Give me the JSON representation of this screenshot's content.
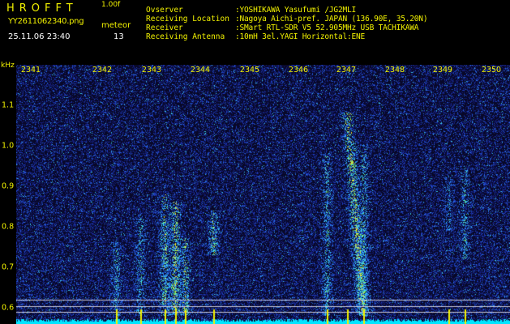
{
  "header": {
    "app_title": "HROFFT",
    "app_version": "1.00f",
    "file_name": "YY2611062340.png",
    "mode": "meteor",
    "timestamp": "25.11.06 23:40",
    "count": "13"
  },
  "station_info": [
    {
      "label": "Ovserver",
      "value": ":YOSHIKAWA Yasufumi /JG2MLI"
    },
    {
      "label": "Receiving Location",
      "value": ":Nagoya Aichi-pref. JAPAN (136.90E, 35.20N)"
    },
    {
      "label": "Receiver",
      "value": ":SMart RTL-SDR V5 52.905MHz USB TACHIKAWA"
    },
    {
      "label": "Receiving Antenna",
      "value": ":10mH 3el.YAGI Horizontal:ENE"
    }
  ],
  "spectrogram": {
    "time_ticks": [
      "2341",
      "2342",
      "2343",
      "2344",
      "2345",
      "2346",
      "2347",
      "2348",
      "2349",
      "2350"
    ],
    "freq_unit": "kHz",
    "freq_ticks": [
      "1.1",
      "1.0",
      "0.9",
      "0.8",
      "0.7",
      "0.6"
    ],
    "freq_range_khz": [
      0.555,
      1.19
    ],
    "colors": {
      "background": "#06061c",
      "text_yellow": "#f2f200",
      "text_white": "#ffffff",
      "baseline": "#00e5ff",
      "marker_lines": "#c8c8d8"
    },
    "marker_lines_khz": [
      0.62,
      0.605,
      0.59
    ],
    "meteor_echoes": [
      {
        "time": "2342:45",
        "freq_low": 0.58,
        "freq_high": 0.76,
        "strength": 0.55
      },
      {
        "time": "2343:15",
        "freq_low": 0.58,
        "freq_high": 0.83,
        "strength": 0.5
      },
      {
        "time": "2343:45",
        "freq_low": 0.58,
        "freq_high": 0.88,
        "strength": 0.7
      },
      {
        "time": "2343:58",
        "freq_low": 0.58,
        "freq_high": 0.86,
        "strength": 0.8
      },
      {
        "time": "2344:10",
        "freq_low": 0.58,
        "freq_high": 0.77,
        "strength": 0.7
      },
      {
        "time": "2344:45",
        "freq_low": 0.73,
        "freq_high": 0.84,
        "strength": 0.7
      },
      {
        "time": "2347:05",
        "freq_low": 0.58,
        "freq_high": 0.98,
        "strength": 0.55
      },
      {
        "time": "2347:30",
        "freq_low": 0.58,
        "freq_high": 1.08,
        "strength": 0.85
      },
      {
        "time": "2347:50",
        "freq_low": 0.58,
        "freq_high": 1.0,
        "strength": 0.6
      },
      {
        "time": "2349:35",
        "freq_low": 0.79,
        "freq_high": 0.92,
        "strength": 0.4
      },
      {
        "time": "2349:55",
        "freq_low": 0.72,
        "freq_high": 0.95,
        "strength": 0.5
      }
    ]
  }
}
